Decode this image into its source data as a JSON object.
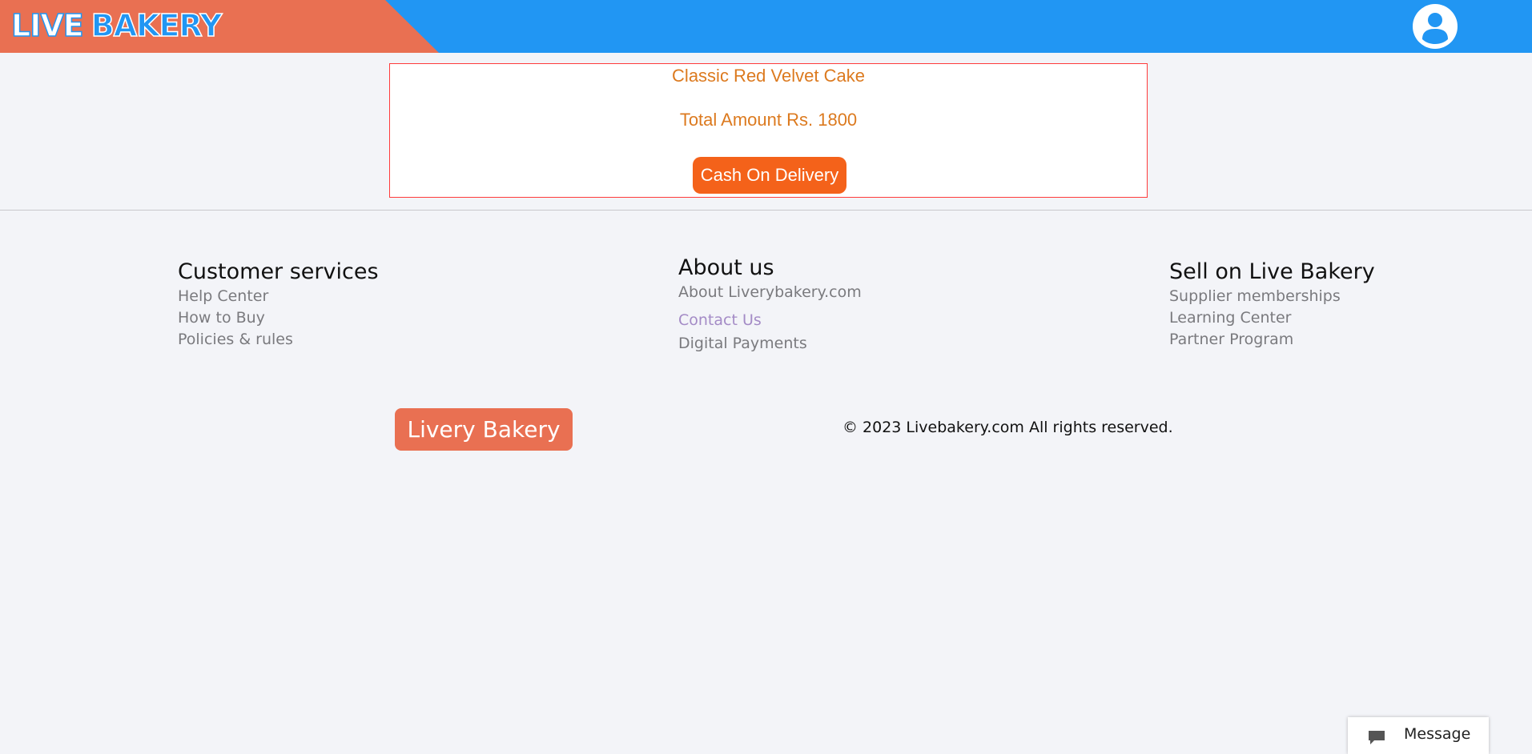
{
  "header": {
    "logo_word1": "LIVE",
    "logo_word2": "BAKERY",
    "icon": "user-icon",
    "colors": {
      "blue": "#2196f3",
      "orange": "#e97052"
    }
  },
  "order": {
    "product_name": "Classic Red Velvet Cake",
    "total_label": "Total Amount Rs. 1800",
    "pay_button": "Cash On Delivery"
  },
  "footer": {
    "customer_services": {
      "title": "Customer services",
      "links": [
        "Help Center",
        "How to Buy",
        "Policies & rules"
      ]
    },
    "about": {
      "title": "About us",
      "links": [
        "About Liverybakery.com",
        "Contact Us",
        "Digital Payments"
      ]
    },
    "sell": {
      "title": "Sell on Live Bakery",
      "links": [
        "Supplier memberships",
        "Learning Center",
        "Partner Program"
      ]
    },
    "brand_button": "Livery Bakery",
    "copyright": "© 2023 Livebakery.com All rights reserved."
  },
  "message_widget": {
    "label": "Message",
    "icon": "chat-icon"
  }
}
